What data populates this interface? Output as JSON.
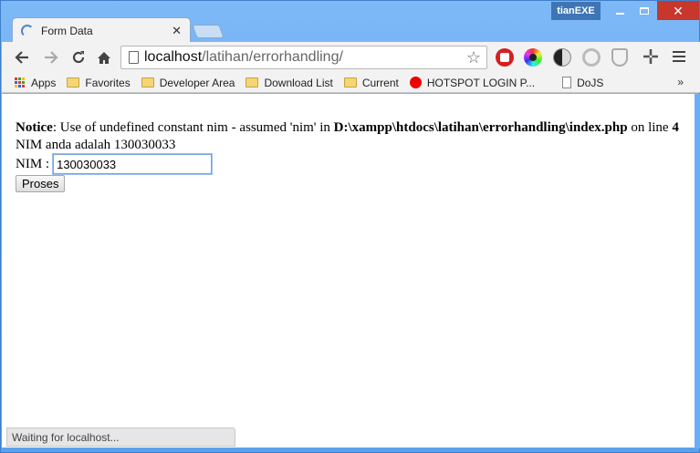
{
  "window": {
    "profile_name": "tianEXE"
  },
  "tabs": [
    {
      "title": "Form Data"
    }
  ],
  "toolbar": {
    "url_host": "localhost",
    "url_path": "/latihan/errorhandling/"
  },
  "bookmarks": {
    "items": [
      {
        "label": "Apps",
        "icon": "apps-icon"
      },
      {
        "label": "Favorites",
        "icon": "folder-icon"
      },
      {
        "label": "Developer Area",
        "icon": "folder-icon"
      },
      {
        "label": "Download List",
        "icon": "folder-icon"
      },
      {
        "label": "Current",
        "icon": "folder-icon"
      },
      {
        "label": "HOTSPOT LOGIN P...",
        "icon": "hotspot-icon"
      },
      {
        "label": "DoJS",
        "icon": "page-icon"
      }
    ],
    "overflow": "»"
  },
  "page": {
    "notice_label": "Notice",
    "notice_text": ": Use of undefined constant nim - assumed 'nim' in ",
    "notice_path": "D:\\xampp\\htdocs\\latihan\\errorhandling\\index.php",
    "notice_line_text": " on line ",
    "notice_line_number": "4",
    "result_text": "NIM anda adalah 130030033",
    "nim_label": "NIM :",
    "nim_value": "130030033",
    "submit_label": "Proses"
  },
  "status": {
    "text": "Waiting for localhost..."
  },
  "colors": {
    "frame": "#6aaef5",
    "close_button": "#c7372c",
    "profile_badge": "#3e75b4"
  }
}
